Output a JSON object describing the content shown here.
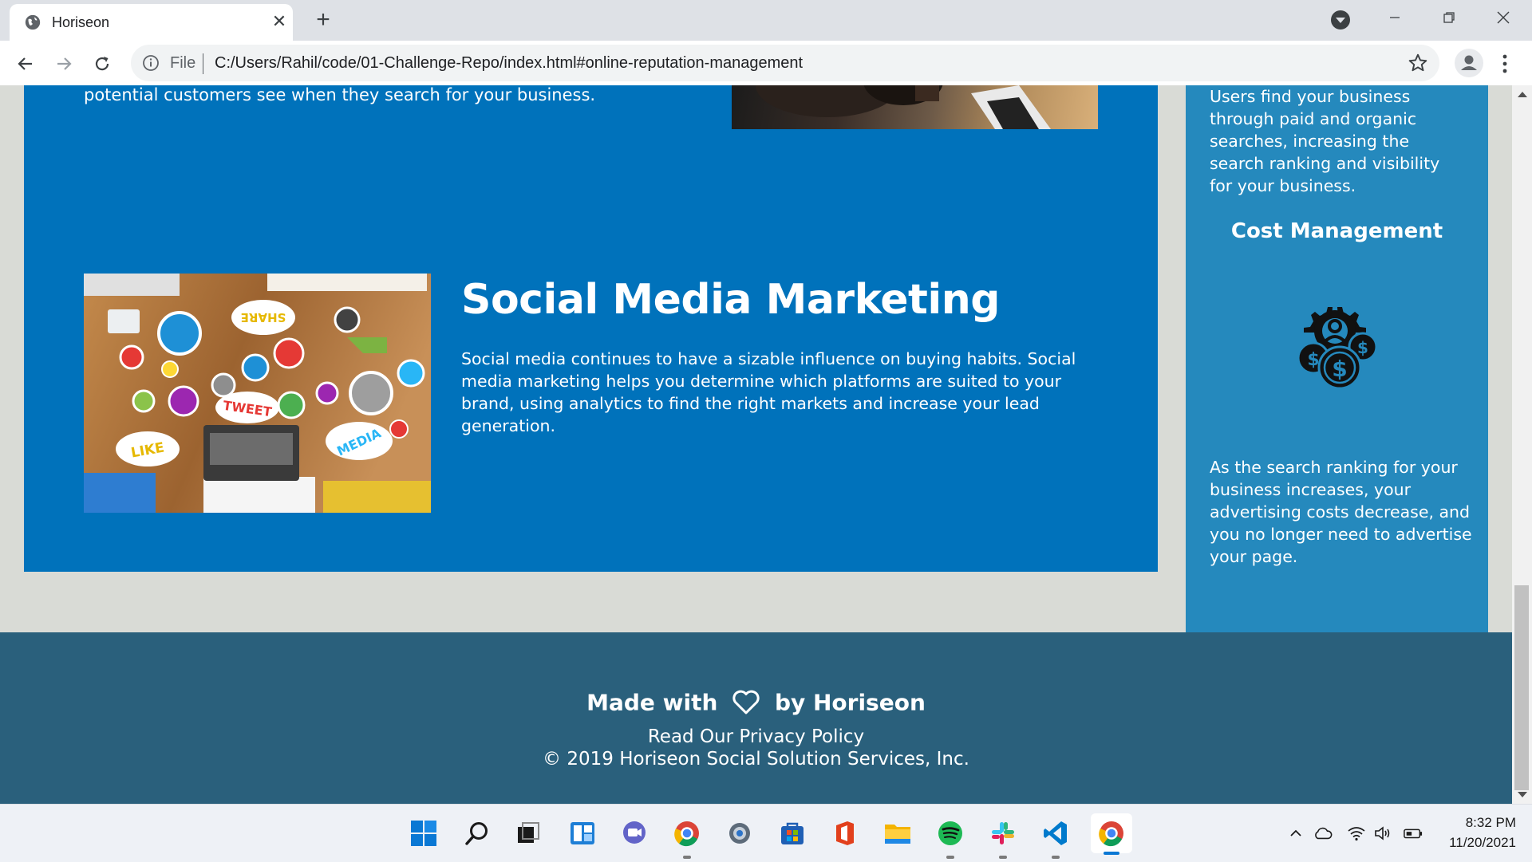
{
  "browser": {
    "tab_title": "Horiseon",
    "new_tab": "+",
    "url_scheme": "File",
    "url": "C:/Users/Rahil/code/01-Challenge-Repo/index.html#online-reputation-management"
  },
  "page": {
    "top_section_text": "potential customers see when they search for your business.",
    "social": {
      "title": "Social Media Marketing",
      "body": "Social media continues to have a sizable influence on buying habits. Social media marketing helps you determine which platforms are suited to your brand, using analytics to find the right markets and increase your lead generation."
    },
    "aside": {
      "text1": "Users find your business through paid and organic searches, increasing the search ranking and visibility for your business.",
      "heading": "Cost Management",
      "text2": "As the search ranking for your business increases, your advertising costs decrease, and you no longer need to advertise your page."
    },
    "footer": {
      "made_with": "Made with",
      "by": "by Horiseon",
      "privacy": "Read Our Privacy Policy",
      "copyright": "© 2019 Horiseon Social Solution Services, Inc."
    },
    "image_stickers": [
      "SHARE",
      "TWEET",
      "LIKE",
      "MEDIA"
    ]
  },
  "taskbar": {
    "time": "8:32 PM",
    "date": "11/20/2021",
    "apps": [
      "windows-start-icon",
      "search-icon",
      "task-view-icon",
      "widgets-icon",
      "teams-chat-icon",
      "chrome-icon",
      "settings-icon",
      "store-icon",
      "office-icon",
      "file-explorer-icon",
      "spotify-icon",
      "slack-icon",
      "vscode-icon",
      "chrome-active-icon"
    ]
  },
  "colors": {
    "section_blue": "#0072bb",
    "aside_blue": "#2589bd",
    "footer": "#2a607c",
    "background": "#d9dbd6"
  }
}
